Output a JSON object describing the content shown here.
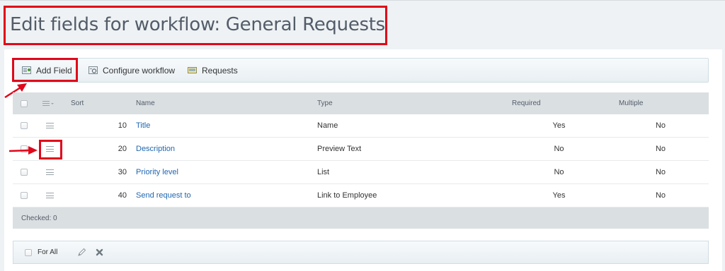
{
  "page": {
    "title": "Edit fields for workflow: General Requests"
  },
  "toolbar": {
    "add_field": "Add Field",
    "configure_workflow": "Configure workflow",
    "requests": "Requests"
  },
  "grid": {
    "columns": {
      "sort": "Sort",
      "name": "Name",
      "type": "Type",
      "required": "Required",
      "multiple": "Multiple"
    },
    "rows": [
      {
        "sort": "10",
        "name": "Title",
        "type": "Name",
        "required": "Yes",
        "multiple": "No"
      },
      {
        "sort": "20",
        "name": "Description",
        "type": "Preview Text",
        "required": "No",
        "multiple": "No"
      },
      {
        "sort": "30",
        "name": "Priority level",
        "type": "List",
        "required": "No",
        "multiple": "No"
      },
      {
        "sort": "40",
        "name": "Send request to",
        "type": "Link to Employee",
        "required": "Yes",
        "multiple": "No"
      }
    ],
    "checked": "Checked: 0"
  },
  "actions": {
    "for_all": "For All",
    "edit_icon": "pencil-icon",
    "delete_icon": "delete-x-icon"
  },
  "colors": {
    "highlight": "#e0071b",
    "link": "#2067b0",
    "title": "#535c69"
  }
}
